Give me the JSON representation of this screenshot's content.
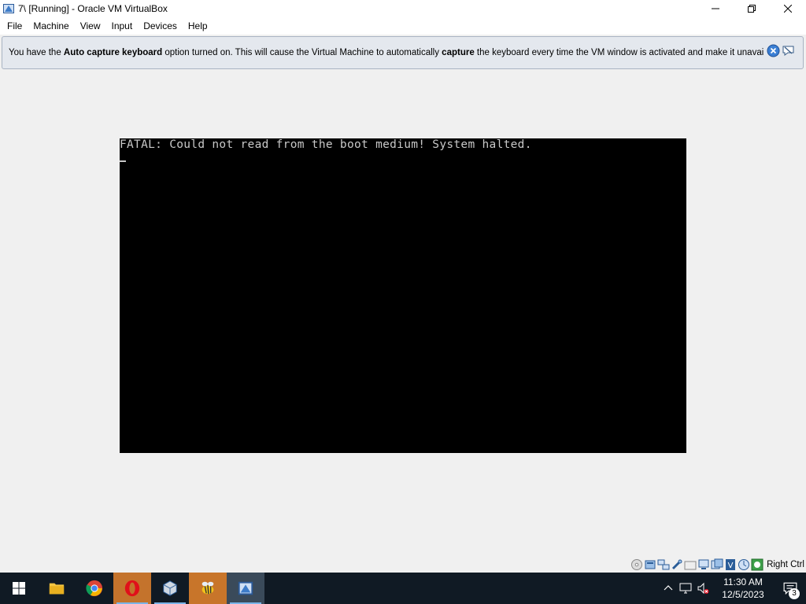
{
  "window": {
    "title": "7\\ [Running] - Oracle VM VirtualBox"
  },
  "menu": [
    "File",
    "Machine",
    "View",
    "Input",
    "Devices",
    "Help"
  ],
  "notice": {
    "part1": "You have the ",
    "bold1": "Auto capture keyboard",
    "part2": " option turned on. This will cause the Virtual Machine to automatically ",
    "bold2": "capture",
    "part3": " the keyboard every time the VM window is activated and make it unavailable to"
  },
  "vm": {
    "message": "FATAL: Could not read from the boot medium! System halted."
  },
  "statusbar": {
    "host_key": "Right Ctrl"
  },
  "taskbar": {
    "time": "11:30 AM",
    "date": "12/5/2023",
    "notifications": "3"
  }
}
